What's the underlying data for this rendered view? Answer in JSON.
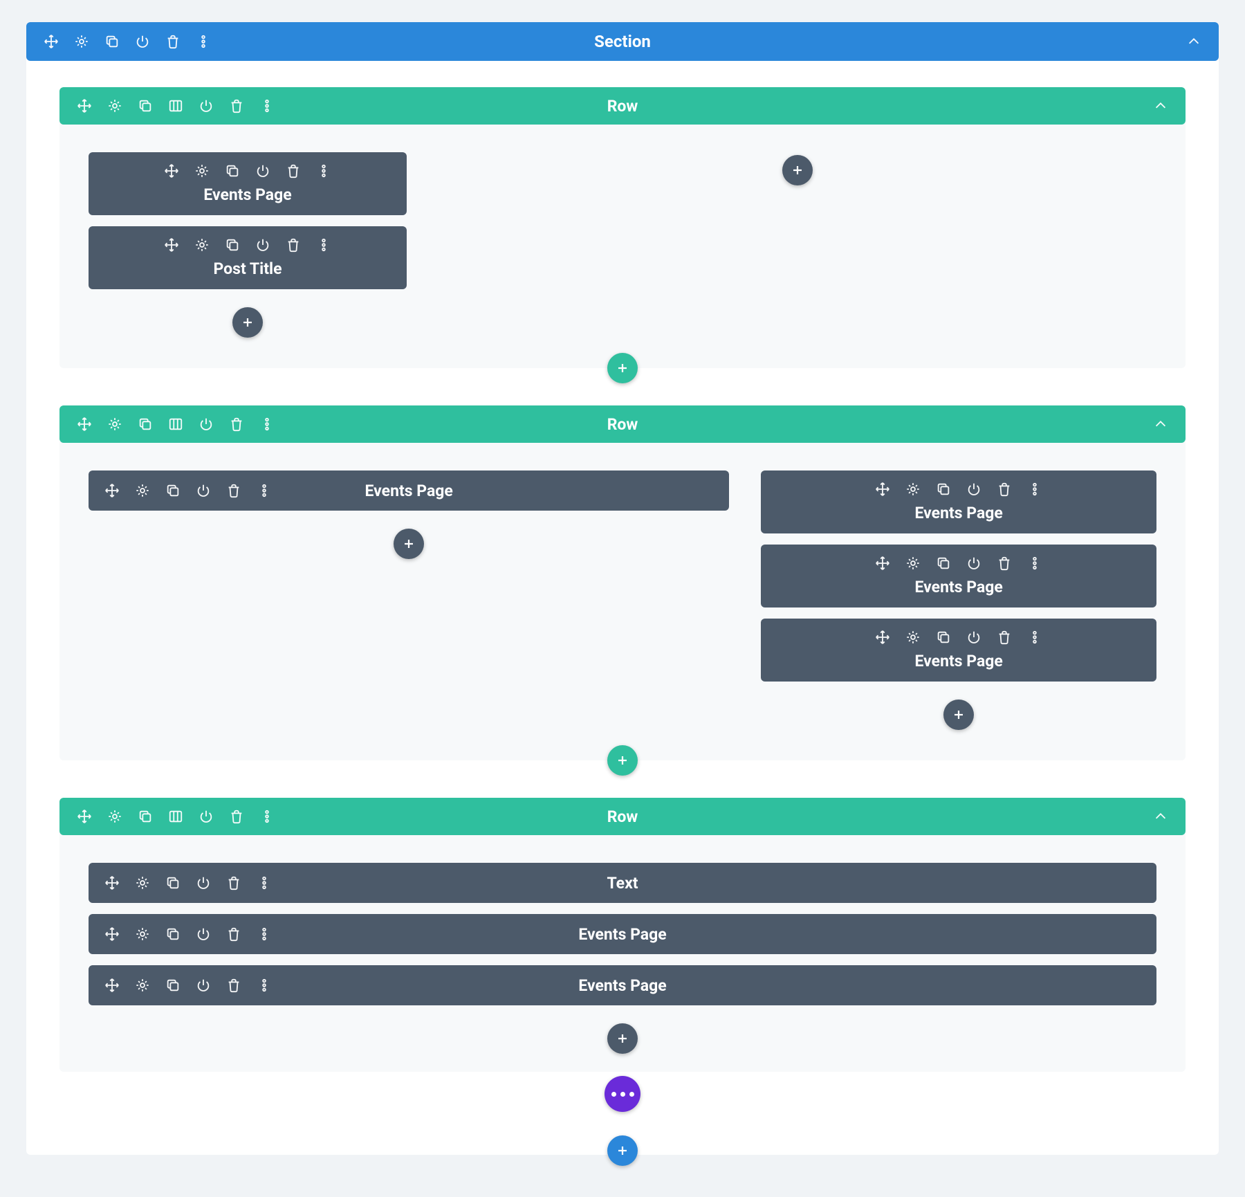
{
  "section": {
    "title": "Section",
    "rows": [
      {
        "title": "Row",
        "columns": [
          {
            "modules": [
              {
                "label": "Events Page"
              },
              {
                "label": "Post Title"
              }
            ]
          },
          {
            "modules": []
          }
        ]
      },
      {
        "title": "Row",
        "columns": [
          {
            "modules": [
              {
                "label": "Events Page"
              }
            ]
          },
          {
            "modules": [
              {
                "label": "Events Page"
              },
              {
                "label": "Events Page"
              },
              {
                "label": "Events Page"
              }
            ]
          }
        ]
      },
      {
        "title": "Row",
        "columns": [
          {
            "modules": [
              {
                "label": "Text"
              },
              {
                "label": "Events Page"
              },
              {
                "label": "Events Page"
              }
            ]
          }
        ]
      }
    ]
  },
  "icons": {
    "move": "move-icon",
    "gear": "gear-icon",
    "clone": "clone-icon",
    "columns": "columns-icon",
    "power": "power-icon",
    "trash": "trash-icon",
    "more": "more-icon",
    "chevron": "chevron-up-icon",
    "plus": "plus-icon"
  }
}
